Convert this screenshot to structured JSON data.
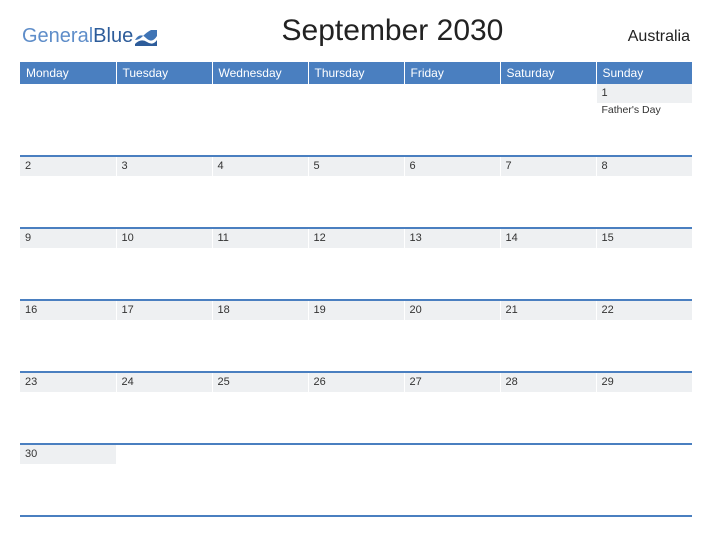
{
  "logo": {
    "part1": "General",
    "part2": "Blue"
  },
  "title": "September 2030",
  "region": "Australia",
  "weekdays": [
    "Monday",
    "Tuesday",
    "Wednesday",
    "Thursday",
    "Friday",
    "Saturday",
    "Sunday"
  ],
  "weeks": [
    [
      {
        "n": "",
        "h": ""
      },
      {
        "n": "",
        "h": ""
      },
      {
        "n": "",
        "h": ""
      },
      {
        "n": "",
        "h": ""
      },
      {
        "n": "",
        "h": ""
      },
      {
        "n": "",
        "h": ""
      },
      {
        "n": "1",
        "h": "Father's Day"
      }
    ],
    [
      {
        "n": "2",
        "h": ""
      },
      {
        "n": "3",
        "h": ""
      },
      {
        "n": "4",
        "h": ""
      },
      {
        "n": "5",
        "h": ""
      },
      {
        "n": "6",
        "h": ""
      },
      {
        "n": "7",
        "h": ""
      },
      {
        "n": "8",
        "h": ""
      }
    ],
    [
      {
        "n": "9",
        "h": ""
      },
      {
        "n": "10",
        "h": ""
      },
      {
        "n": "11",
        "h": ""
      },
      {
        "n": "12",
        "h": ""
      },
      {
        "n": "13",
        "h": ""
      },
      {
        "n": "14",
        "h": ""
      },
      {
        "n": "15",
        "h": ""
      }
    ],
    [
      {
        "n": "16",
        "h": ""
      },
      {
        "n": "17",
        "h": ""
      },
      {
        "n": "18",
        "h": ""
      },
      {
        "n": "19",
        "h": ""
      },
      {
        "n": "20",
        "h": ""
      },
      {
        "n": "21",
        "h": ""
      },
      {
        "n": "22",
        "h": ""
      }
    ],
    [
      {
        "n": "23",
        "h": ""
      },
      {
        "n": "24",
        "h": ""
      },
      {
        "n": "25",
        "h": ""
      },
      {
        "n": "26",
        "h": ""
      },
      {
        "n": "27",
        "h": ""
      },
      {
        "n": "28",
        "h": ""
      },
      {
        "n": "29",
        "h": ""
      }
    ],
    [
      {
        "n": "30",
        "h": ""
      },
      {
        "n": "",
        "h": ""
      },
      {
        "n": "",
        "h": ""
      },
      {
        "n": "",
        "h": ""
      },
      {
        "n": "",
        "h": ""
      },
      {
        "n": "",
        "h": ""
      },
      {
        "n": "",
        "h": ""
      }
    ]
  ]
}
